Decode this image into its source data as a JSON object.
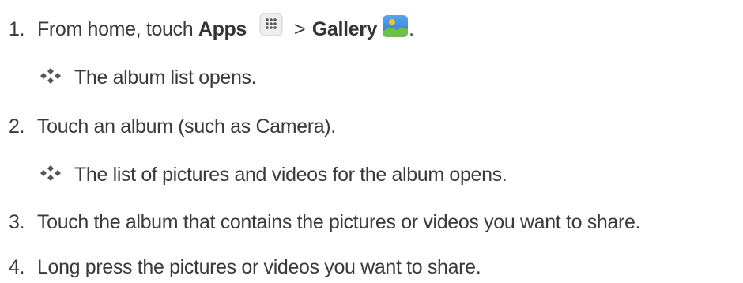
{
  "steps": [
    {
      "number": "1.",
      "text_prefix": "From home, touch ",
      "apps_label": "Apps",
      "separator": ">",
      "gallery_label": "Gallery",
      "text_suffix": "."
    },
    {
      "number": "2.",
      "text": "Touch an album (such as Camera)."
    },
    {
      "number": "3.",
      "text": "Touch the album that contains the pictures or videos you want to share."
    },
    {
      "number": "4.",
      "text": "Long press the pictures or videos you want to share."
    }
  ],
  "results": [
    "The album list opens.",
    "The list of pictures and videos for the album opens."
  ],
  "icons": {
    "apps": "apps-grid-icon",
    "gallery": "gallery-icon",
    "result_bullet": "result-bullet-icon"
  },
  "colors": {
    "text": "#3a3a3a",
    "bullet": "#555555",
    "gallery_sky": "#3f8fe0",
    "gallery_hill": "#6cc04a",
    "gallery_sun": "#f2c230"
  }
}
